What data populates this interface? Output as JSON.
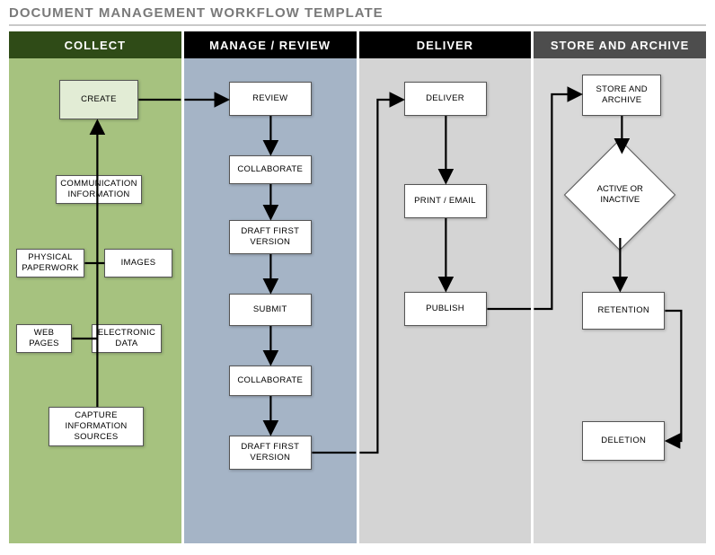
{
  "title": "DOCUMENT MANAGEMENT WORKFLOW TEMPLATE",
  "columns": {
    "col1": {
      "header": "COLLECT",
      "create": "CREATE",
      "comm": "COMMUNICATION INFORMATION",
      "physical": "PHYSICAL PAPERWORK",
      "images": "IMAGES",
      "web": "WEB PAGES",
      "edata": "ELECTRONIC DATA",
      "capture": "CAPTURE INFORMATION SOURCES"
    },
    "col2": {
      "header": "MANAGE / REVIEW",
      "review": "REVIEW",
      "collab1": "COLLABORATE",
      "draft1": "DRAFT FIRST VERSION",
      "submit": "SUBMIT",
      "collab2": "COLLABORATE",
      "draft2": "DRAFT FIRST VERSION"
    },
    "col3": {
      "header": "DELIVER",
      "deliver": "DELIVER",
      "print": "PRINT / EMAIL",
      "publish": "PUBLISH"
    },
    "col4": {
      "header": "STORE AND ARCHIVE",
      "store": "STORE AND ARCHIVE",
      "decision": "ACTIVE OR INACTIVE",
      "retention": "RETENTION",
      "deletion": "DELETION"
    }
  }
}
